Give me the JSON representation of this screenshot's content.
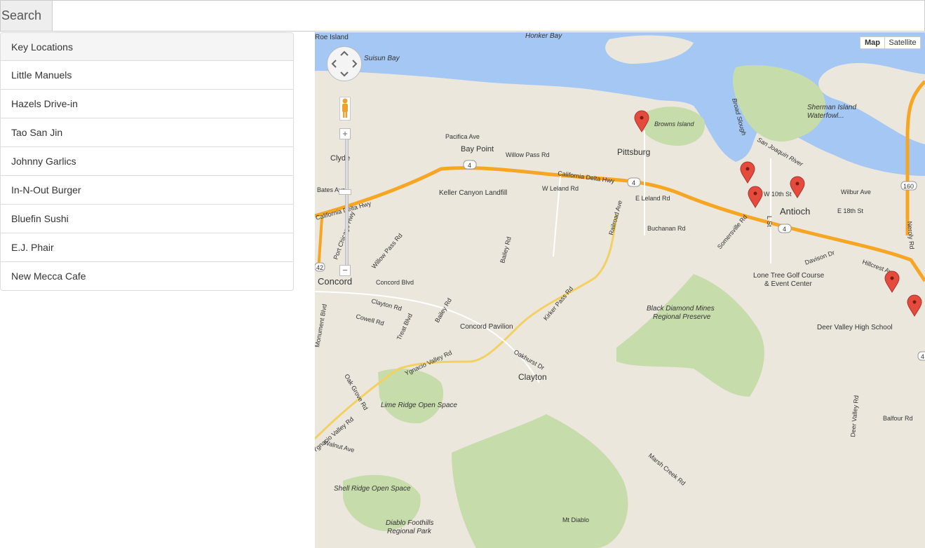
{
  "search": {
    "button_label": "Search",
    "input_value": "",
    "input_placeholder": ""
  },
  "locations": {
    "header": "Key Locations",
    "items": [
      "Little Manuels",
      "Hazels Drive-in",
      "Tao San Jin",
      "Johnny Garlics",
      "In-N-Out Burger",
      "Bluefin Sushi",
      "E.J. Phair",
      "New Mecca Cafe"
    ]
  },
  "map": {
    "type_buttons": {
      "map": "Map",
      "satellite": "Satellite",
      "active": "Map"
    },
    "zoom_in": "+",
    "zoom_out": "−",
    "colors": {
      "water": "#a4c7f3",
      "land": "#ece7dd",
      "park": "#c7dcab",
      "highway": "#f6a623",
      "road": "#f3d062",
      "marker": "#e44b3c"
    },
    "places": {
      "roe_island": "Roe Island",
      "honker_bay": "Honker Bay",
      "suisun_bay": "Suisun Bay",
      "browns_island": "Browns Island",
      "sherman_island": "Sherman Island\nWaterfowl...",
      "broad_slough": "Broad Slough",
      "san_joaquin": "San Joaquin River",
      "pacifica": "Pacifica Ave",
      "bay_point": "Bay Point",
      "willow_pass": "Willow Pass Rd",
      "pittsburg": "Pittsburg",
      "clyde": "Clyde",
      "cal_delta1": "California Delta Hwy",
      "cal_delta2": "California Delta Hwy",
      "keller": "Keller Canyon Landfill",
      "w_leland": "W Leland Rd",
      "e_leland": "E Leland Rd",
      "buchanan": "Buchanan Rd",
      "w10th": "W 10th St",
      "antioch": "Antioch",
      "e18th": "E 18th St",
      "wilbur": "Wilbur Ave",
      "l_st": "L St",
      "somersville": "Somersville Rd",
      "davison": "Davison Dr",
      "hillcrest": "Hillcrest Ave",
      "lone_tree": "Lone Tree Golf Course",
      "event_center": "& Event Center",
      "bates": "Bates Ave",
      "port_chicago": "Port Chicago Hwy",
      "willow_pass2": "Willow Pass Rd",
      "concord": "Concord",
      "concord_blvd": "Concord Blvd",
      "clayton_rd": "Clayton Rd",
      "cowell": "Cowell Rd",
      "treat": "Treat Blvd",
      "bailey": "Bailey Rd",
      "bailey2": "Bailey Rd",
      "railroad": "Railroad Ave",
      "kirker": "Kirker Pass Rd",
      "concord_pav": "Concord Pavilion",
      "ygnacio": "Ygnacio Valley Rd",
      "oakhurst": "Oakhurst Dr",
      "clayton": "Clayton",
      "oak_grove": "Oak Grove Rd",
      "lime_ridge": "Lime Ridge Open Space",
      "ygnacio2": "Ygnacio Valley Rd",
      "walnut": "Walnut Ave",
      "monument": "Monument Blvd",
      "black_diamond": "Black Diamond Mines",
      "regional_pres": "Regional Preserve",
      "deer_valley": "Deer Valley High School",
      "deer_valley_rd": "Deer Valley Rd",
      "balfour": "Balfour Rd",
      "neroly": "Neroly Rd",
      "marsh": "Marsh Creek Rd",
      "shell_ridge": "Shell Ridge Open Space",
      "diablo_foot": "Diablo Foothills",
      "regional_park": "Regional Park",
      "mt_diablo": "Mt Diablo",
      "hwy4a": "4",
      "hwy4b": "4",
      "hwy4c": "4",
      "hwy4d": "4",
      "hwy160": "160",
      "hwy242": "42"
    }
  }
}
